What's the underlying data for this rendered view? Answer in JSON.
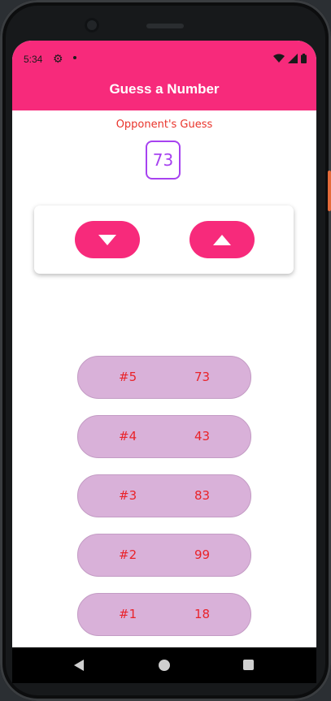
{
  "status_bar": {
    "time": "5:34",
    "gear_icon": "settings-gear-icon",
    "wifi_icon": "wifi-icon",
    "signal_icon": "cell-signal-icon",
    "battery_icon": "battery-icon"
  },
  "app_bar": {
    "title": "Guess a Number"
  },
  "opponent": {
    "label": "Opponent's Guess",
    "value": "73"
  },
  "controls": {
    "lower_icon": "triangle-down-icon",
    "higher_icon": "triangle-up-icon"
  },
  "guess_log": [
    {
      "round": "#5",
      "value": "73"
    },
    {
      "round": "#4",
      "value": "43"
    },
    {
      "round": "#3",
      "value": "83"
    },
    {
      "round": "#2",
      "value": "99"
    },
    {
      "round": "#1",
      "value": "18"
    }
  ],
  "colors": {
    "primary": "#f72a7b",
    "accent_text": "#e9332a",
    "guess_border": "#a742f0",
    "log_item_bg": "#d9b1d9"
  }
}
